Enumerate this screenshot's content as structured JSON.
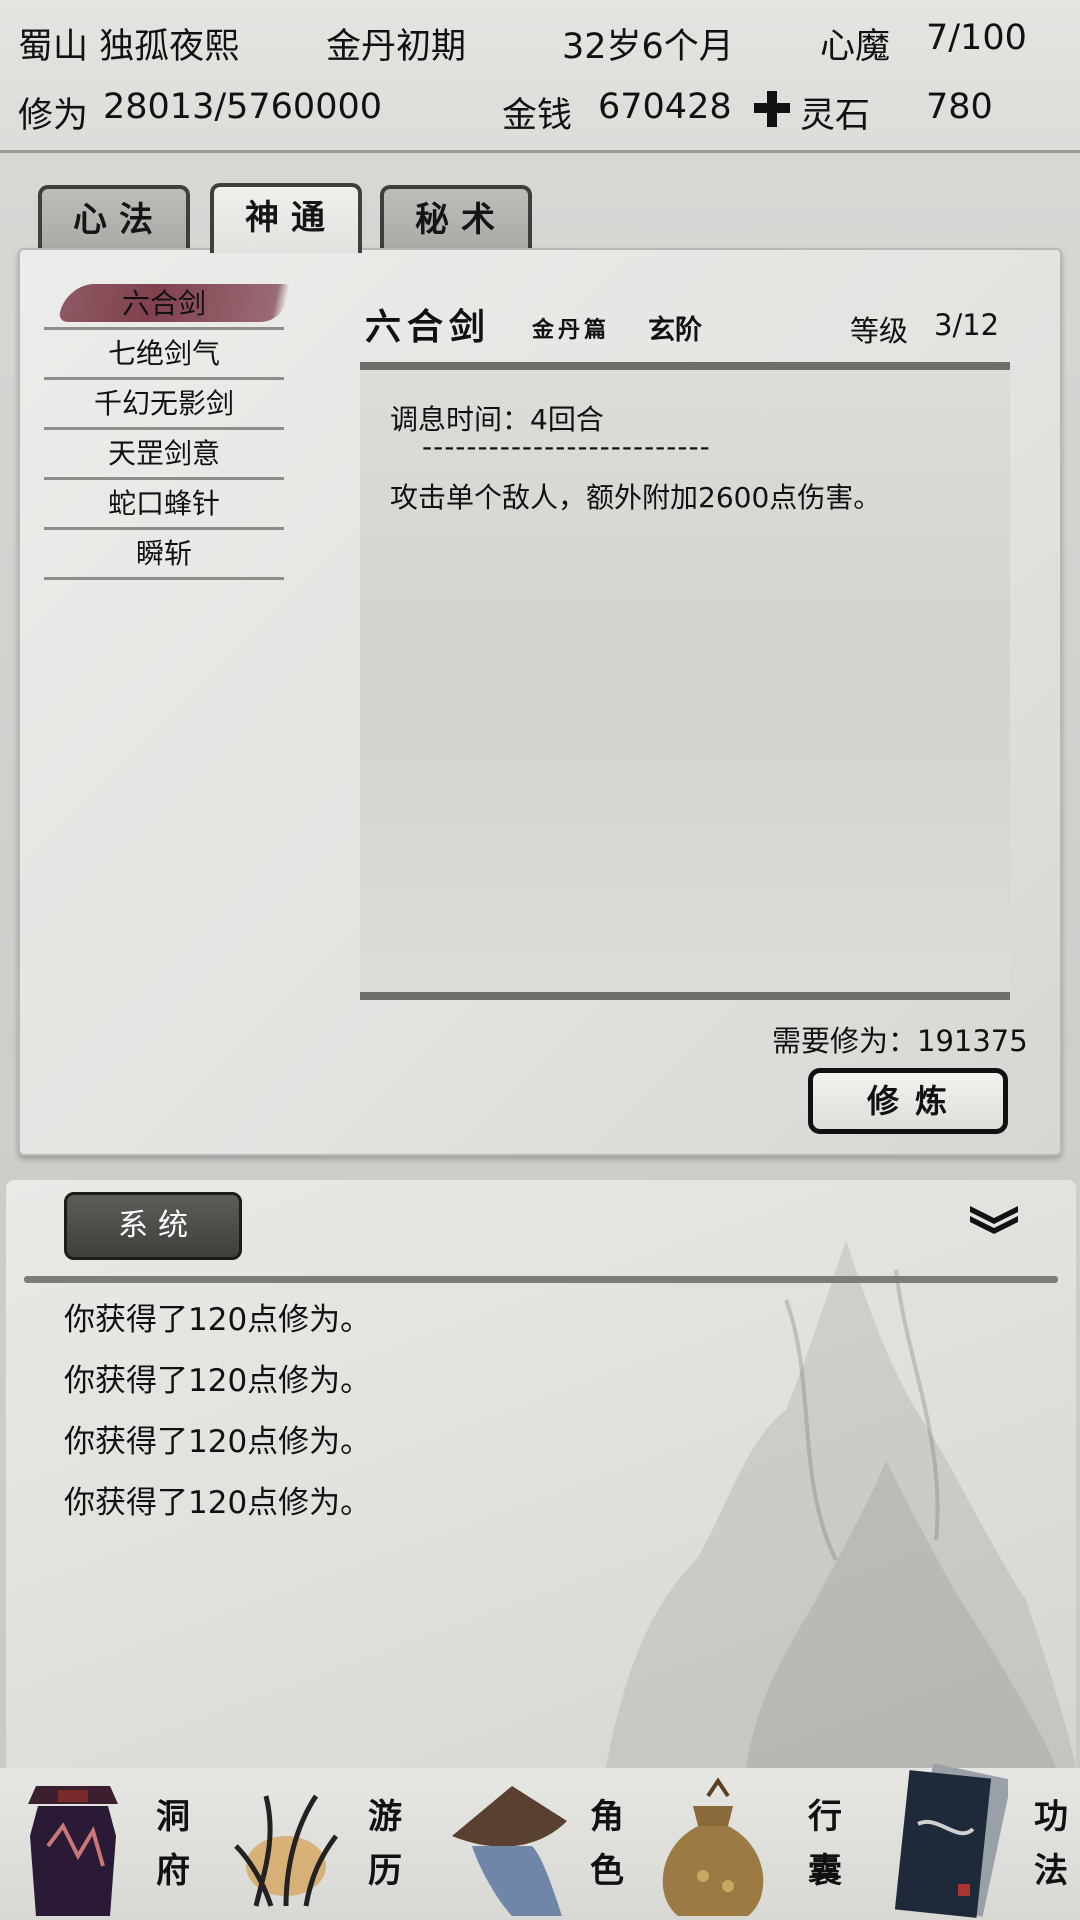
{
  "header": {
    "sect_name": "蜀山 独孤夜熙",
    "realm": "金丹初期",
    "age": "32岁6个月",
    "demon_label": "心魔",
    "demon_value": "7/100",
    "cultivation_label": "修为",
    "cultivation_value": "28013/5760000",
    "money_label": "金钱",
    "money_value": "670428",
    "spirit_stone_icon": "spirit-stone-icon",
    "spirit_stone_label": "灵石",
    "spirit_stone_value": "780"
  },
  "tabs": [
    {
      "label": "心法",
      "active": false
    },
    {
      "label": "神通",
      "active": true
    },
    {
      "label": "秘术",
      "active": false
    }
  ],
  "skills": [
    "六合剑",
    "七绝剑气",
    "千幻无影剑",
    "天罡剑意",
    "蛇口蜂针",
    "瞬斩"
  ],
  "selected_skill": {
    "name": "六合剑",
    "volume": "金丹篇",
    "grade": "玄阶",
    "level_label": "等级",
    "level_value": "3/12",
    "cooldown": "调息时间：4回合",
    "separator": "--------------------------",
    "description": "攻击单个敌人，额外附加2600点伤害。",
    "required": "需要修为：191375",
    "train_button": "修炼"
  },
  "log": {
    "channel_button": "系统",
    "collapse_icon": "double-chevron-down-icon",
    "lines": [
      "你获得了120点修为。",
      "你获得了120点修为。",
      "你获得了120点修为。",
      "你获得了120点修为。"
    ]
  },
  "nav": [
    {
      "label": "洞府",
      "icon": "cave-residence-icon",
      "active": false
    },
    {
      "label": "游历",
      "icon": "travel-grass-icon",
      "active": false
    },
    {
      "label": "角色",
      "icon": "character-hat-icon",
      "active": false
    },
    {
      "label": "行囊",
      "icon": "bag-icon",
      "active": false
    },
    {
      "label": "功法",
      "icon": "scripture-book-icon",
      "active": true
    }
  ],
  "colors": {
    "selected_highlight": "#7a3545",
    "divider": "#7c7c78",
    "button_dark": "#4a4a47"
  }
}
